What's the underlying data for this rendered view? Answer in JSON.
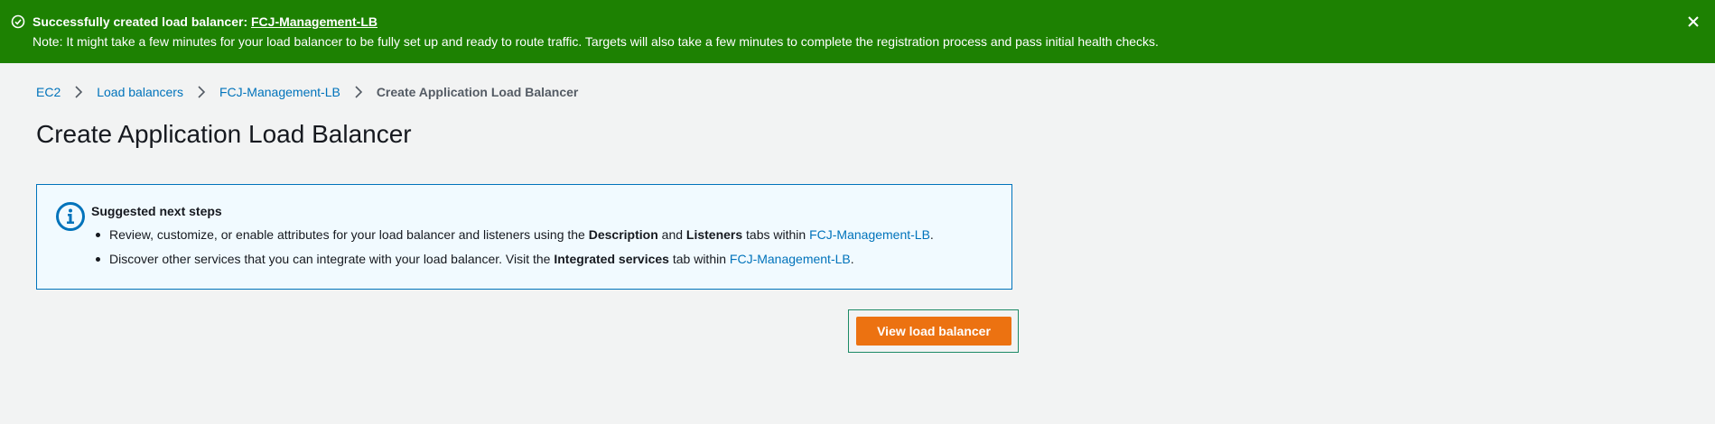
{
  "flash": {
    "title_prefix": "Successfully created load balancer: ",
    "title_link": "FCJ-Management-LB",
    "note": "Note: It might take a few minutes for your load balancer to be fully set up and ready to route traffic. Targets will also take a few minutes to complete the registration process and pass initial health checks.",
    "status_color": "#1d8102",
    "icons": {
      "status": "check-circle-icon",
      "dismiss": "close-icon"
    }
  },
  "breadcrumb": {
    "items": [
      "EC2",
      "Load balancers",
      "FCJ-Management-LB"
    ],
    "current": "Create Application Load Balancer"
  },
  "page": {
    "title": "Create Application Load Balancer"
  },
  "info_box": {
    "title": "Suggested next steps",
    "icon": "info-icon",
    "item1": {
      "text_a": "Review, customize, or enable attributes for your load balancer and listeners using the ",
      "bold_a": "Description",
      "text_b": " and ",
      "bold_b": "Listeners",
      "text_c": " tabs within ",
      "link": "FCJ-Management-LB",
      "text_d": "."
    },
    "item2": {
      "text_a": "Discover other services that you can integrate with your load balancer. Visit the ",
      "bold_a": "Integrated services",
      "text_b": " tab within ",
      "link": "FCJ-Management-LB",
      "text_c": "."
    }
  },
  "actions": {
    "view_label": "View load balancer",
    "primary_color": "#ec7211"
  }
}
